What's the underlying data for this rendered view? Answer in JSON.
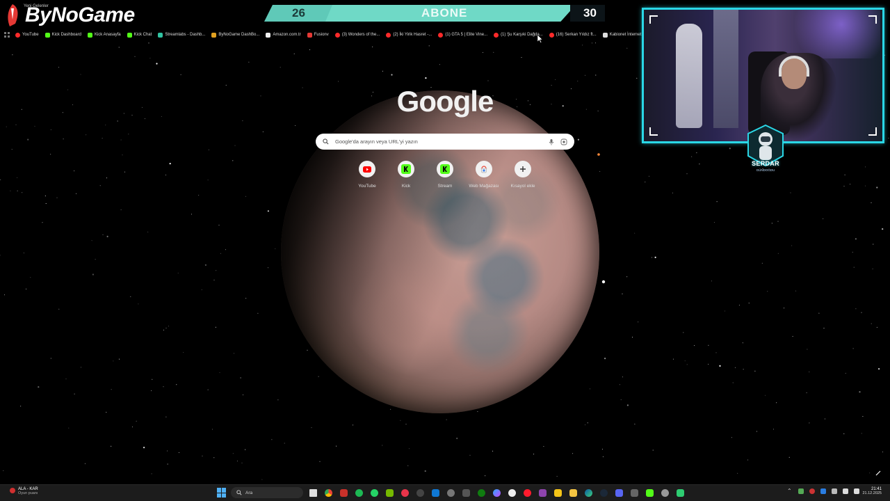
{
  "overlay": {
    "brand": "ByNoGame",
    "brand_tag": "Yeni Gelenler",
    "subs_current": "26",
    "subs_label": "ABONE",
    "subs_goal": "30",
    "streamer_name": "SERDAR",
    "streamer_sub": "GÜNDOĞDU"
  },
  "bookmarks": [
    {
      "label": "YouTube",
      "icon": "youtube-icon",
      "color": "#ff2a2a"
    },
    {
      "label": "Kick Dashboard",
      "icon": "kick-icon",
      "color": "#53fc18"
    },
    {
      "label": "Kick Anasayfa",
      "icon": "kick-icon",
      "color": "#53fc18"
    },
    {
      "label": "Kick Chat",
      "icon": "kick-icon",
      "color": "#53fc18"
    },
    {
      "label": "Streamlabs - Dashb...",
      "icon": "streamlabs-icon",
      "color": "#31c3a2"
    },
    {
      "label": "ByNoGame DashBo...",
      "icon": "bynogame-icon",
      "color": "#e0a020"
    },
    {
      "label": "Amazon.com.tr",
      "icon": "amazon-icon",
      "color": "#f0f0f0"
    },
    {
      "label": "Fusionv",
      "icon": "fusion-icon",
      "color": "#e53935"
    },
    {
      "label": "(3) Wonders of the...",
      "icon": "youtube-icon",
      "color": "#ff2a2a"
    },
    {
      "label": "(2) İki Yirik Hasret -...",
      "icon": "youtube-icon",
      "color": "#ff2a2a"
    },
    {
      "label": "(1) GTA 5 | Elite Vine...",
      "icon": "youtube-icon",
      "color": "#ff2a2a"
    },
    {
      "label": "(1) Şu Karşıki Dağda...",
      "icon": "youtube-icon",
      "color": "#ff2a2a"
    },
    {
      "label": "(16) Serkan Yıldız ft...",
      "icon": "youtube-icon",
      "color": "#ff2a2a"
    },
    {
      "label": "Kabionet İnternet",
      "icon": "page-icon",
      "color": "#dddddd"
    }
  ],
  "google": {
    "logo": "Google",
    "search_placeholder": "Google'da arayın veya URL'yi yazın",
    "shortcuts": [
      {
        "label": "YouTube",
        "icon": "youtube-icon"
      },
      {
        "label": "Kick",
        "icon": "kick-icon"
      },
      {
        "label": "Stream",
        "icon": "kick-icon"
      },
      {
        "label": "Web Mağazası",
        "icon": "web-store-icon"
      },
      {
        "label": "Kısayol ekle",
        "icon": "plus-icon"
      }
    ]
  },
  "taskbar": {
    "weather_title": "ALA - KAR",
    "weather_sub": "Oyun puanı",
    "search_label": "Ara",
    "time": "21:41",
    "date": "21.12.2025"
  },
  "colors": {
    "accent_cyan": "#2ad7e6",
    "sub_bar": "#6fd9c6",
    "search_bg": "#ffffff"
  }
}
